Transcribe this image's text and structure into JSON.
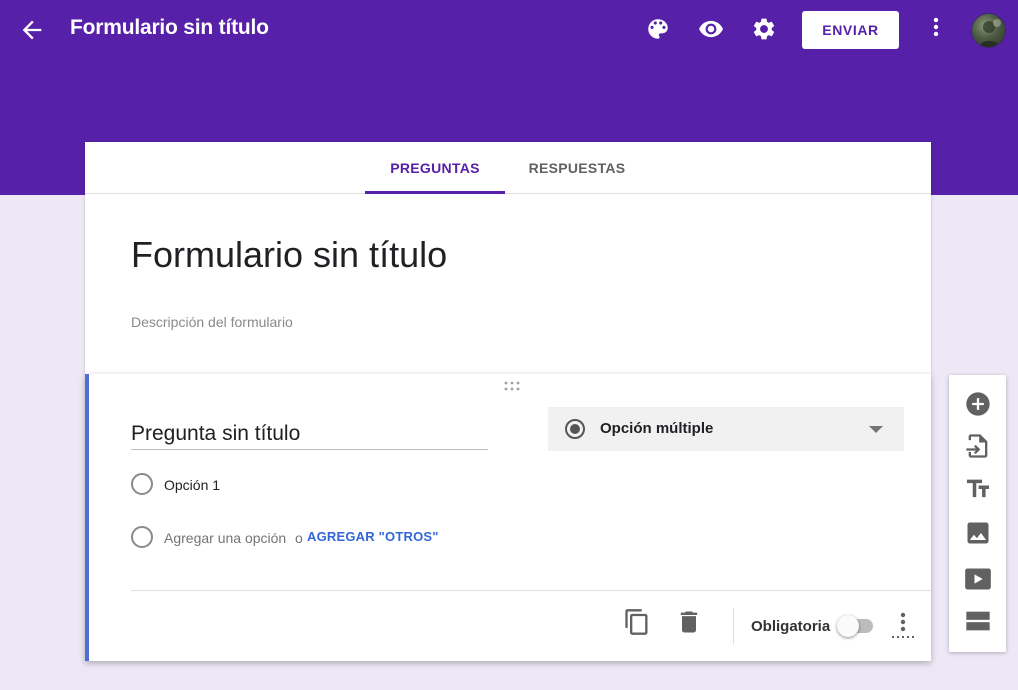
{
  "app": {
    "title": "Formulario sin título"
  },
  "toolbar": {
    "send_label": "ENVIAR",
    "icons": [
      "back-arrow-icon",
      "palette-icon",
      "eye-icon",
      "gear-icon",
      "more-vert-icon"
    ]
  },
  "tabs": [
    {
      "label": "PREGUNTAS",
      "active": true
    },
    {
      "label": "RESPUESTAS",
      "active": false
    }
  ],
  "form": {
    "title": "Formulario sin título",
    "description_placeholder": "Descripción del formulario"
  },
  "question": {
    "title": "Pregunta sin título",
    "type_label": "Opción múltiple",
    "options": [
      {
        "label": "Opción 1"
      }
    ],
    "add_option_label": "Agregar una opción",
    "or_label": "o",
    "add_other_label": "AGREGAR \"OTROS\"",
    "required_label": "Obligatoria",
    "required": false
  },
  "sidebar": {
    "icons": [
      "add-question-icon",
      "import-questions-icon",
      "add-title-icon",
      "add-image-icon",
      "add-video-icon",
      "add-section-icon"
    ]
  },
  "colors": {
    "header": "#5720a8",
    "background": "#ede7f6",
    "accent_blue": "#4e6ed1",
    "link_blue": "#3367d6"
  }
}
